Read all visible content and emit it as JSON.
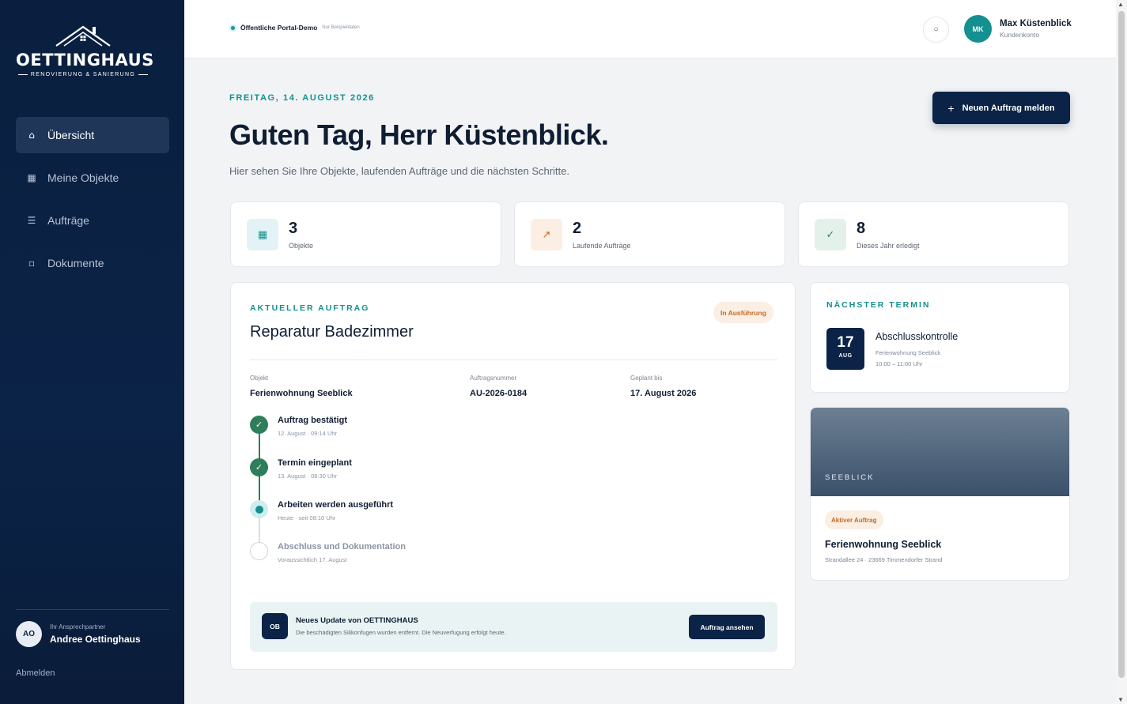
{
  "brand": {
    "name": "OETTINGHAUS",
    "tagline": "RENOVIERUNG & SANIERUNG"
  },
  "sidebar": {
    "items": [
      {
        "label": "Übersicht",
        "icon": "home-icon",
        "glyph": "⌂",
        "active": true
      },
      {
        "label": "Meine Objekte",
        "icon": "grid-icon",
        "glyph": "▦",
        "active": false
      },
      {
        "label": "Aufträge",
        "icon": "list-icon",
        "glyph": "☰",
        "active": false
      },
      {
        "label": "Dokumente",
        "icon": "document-icon",
        "glyph": "▫",
        "active": false
      }
    ],
    "contact": {
      "initials": "AO",
      "label": "Ihr Ansprechpartner",
      "name": "Andree Oettinghaus"
    },
    "logout": "Abmelden"
  },
  "topbar": {
    "demo_label": "Öffentliche Portal-Demo",
    "demo_note": "Nur Beispieldaten",
    "notification_glyph": "○",
    "user": {
      "initials": "MK",
      "name": "Max Küstenblick",
      "role": "Kundenkonto"
    }
  },
  "main": {
    "date": "FREITAG, 14. AUGUST 2026",
    "greeting": "Guten Tag, Herr Küstenblick.",
    "subtitle": "Hier sehen Sie Ihre Objekte, laufenden Aufträge und die nächsten Schritte.",
    "new_order_button": "Neuen Auftrag melden",
    "stats": [
      {
        "value": "3",
        "label": "Objekte",
        "icon": "building-icon",
        "glyph": "▦",
        "bg": "#e3f2f4",
        "fg": "#13908f"
      },
      {
        "value": "2",
        "label": "Laufende Aufträge",
        "icon": "trend-icon",
        "glyph": "↗",
        "bg": "#fbeee3",
        "fg": "#c56a28"
      },
      {
        "value": "8",
        "label": "Dieses Jahr erledigt",
        "icon": "check-icon",
        "glyph": "✓",
        "bg": "#e4f1ea",
        "fg": "#2e7d5b"
      }
    ]
  },
  "current_order": {
    "section": "AKTUELLER AUFTRAG",
    "title": "Reparatur Badezimmer",
    "status": "In Ausführung",
    "fields": [
      {
        "key": "Objekt",
        "value": "Ferienwohnung Seeblick"
      },
      {
        "key": "Auftragsnummer",
        "value": "AU-2026-0184"
      },
      {
        "key": "Geplant bis",
        "value": "17. August 2026"
      }
    ],
    "steps": [
      {
        "title": "Auftrag bestätigt",
        "detail": "12. August · 09:14 Uhr",
        "state": "done"
      },
      {
        "title": "Termin eingeplant",
        "detail": "13. August · 08:30 Uhr",
        "state": "done"
      },
      {
        "title": "Arbeiten werden ausgeführt",
        "detail": "Heute · seit 08:10 Uhr",
        "state": "current"
      },
      {
        "title": "Abschluss und Dokumentation",
        "detail": "Voraussichtlich 17. August",
        "state": "todo"
      }
    ],
    "update": {
      "initials": "OB",
      "title": "Neues Update von OETTINGHAUS",
      "text": "Die beschädigten Silikonfugen wurden entfernt. Die Neuverfugung erfolgt heute.",
      "button": "Auftrag ansehen"
    }
  },
  "next_appointment": {
    "section": "NÄCHSTER TERMIN",
    "day": "17",
    "month": "AUG",
    "title": "Abschlusskontrolle",
    "location": "Ferienwohnung Seeblick",
    "time": "10:00 – 11:00 Uhr"
  },
  "property": {
    "image_label": "SEEBLICK",
    "badge": "Aktiver Auftrag",
    "name": "Ferienwohnung Seeblick",
    "address": "Strandallee 24 · 23669 Timmendorfer Strand"
  }
}
